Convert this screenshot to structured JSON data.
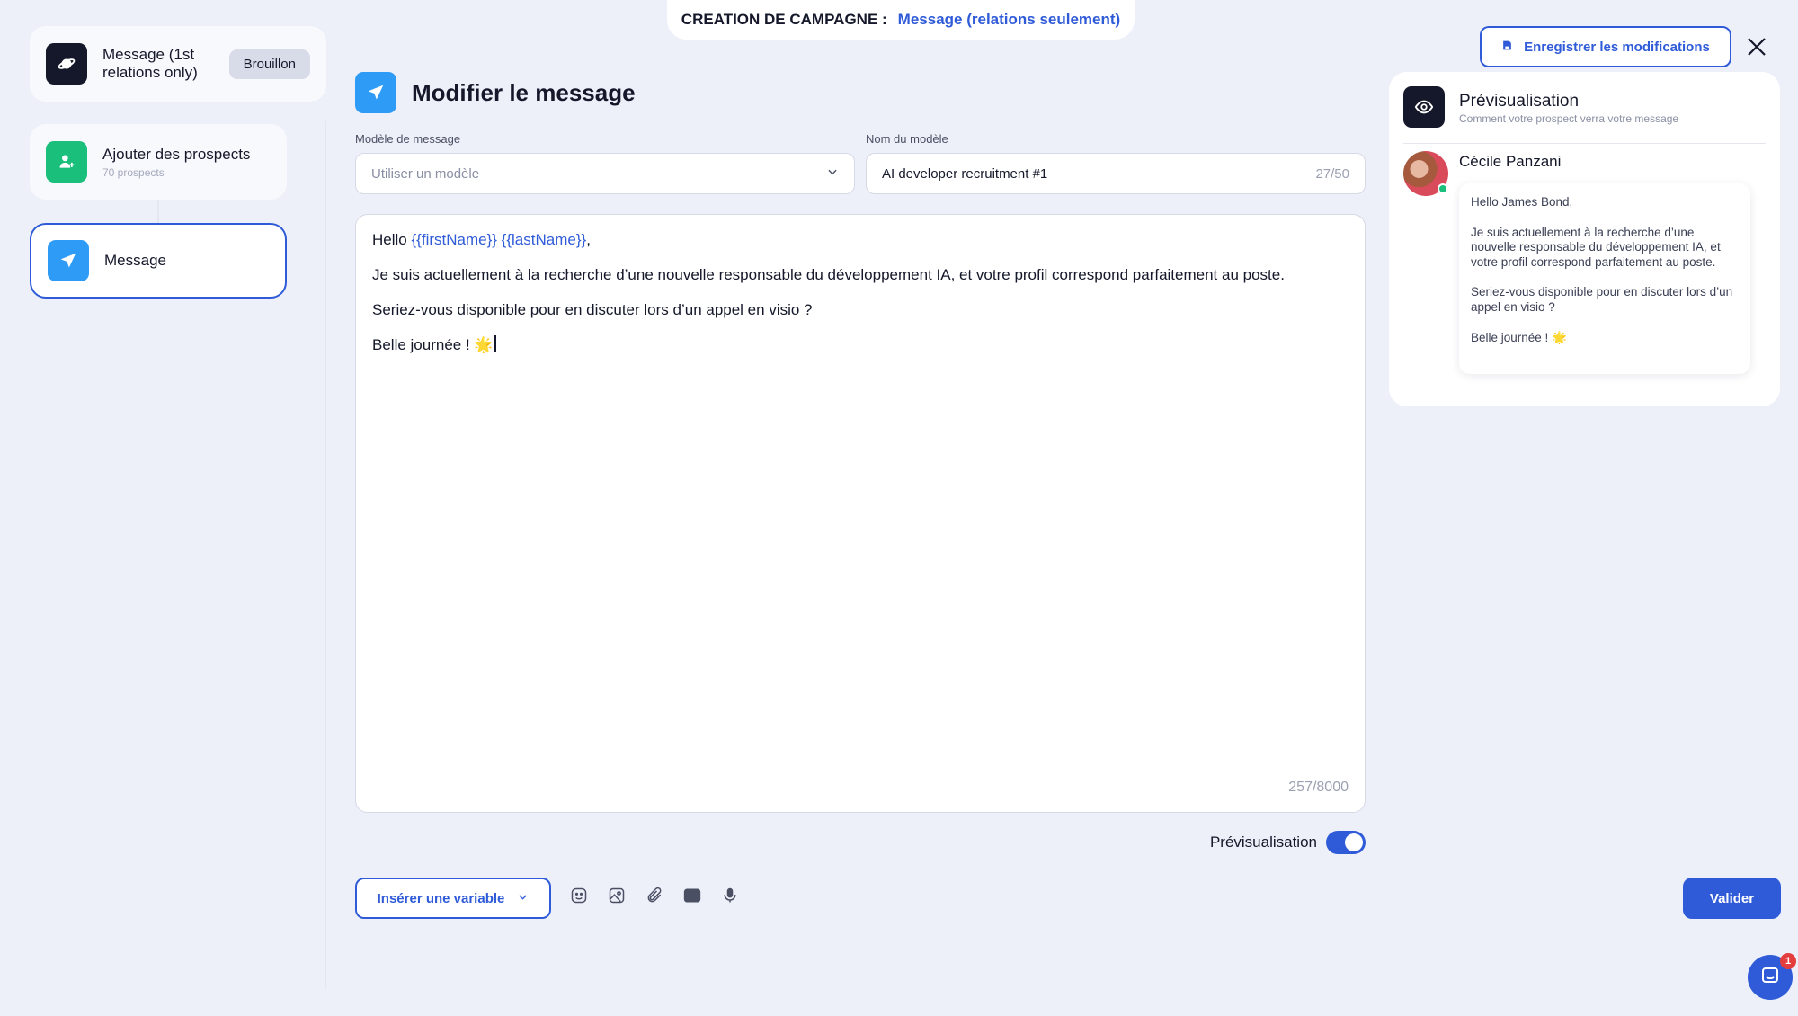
{
  "header": {
    "label": "CREATION DE CAMPAGNE :",
    "value": "Message (relations seulement)"
  },
  "steps": [
    {
      "title": "Message (1st relations only)",
      "badge": "Brouillon",
      "icon": "planet-icon"
    },
    {
      "title": "Ajouter des prospects",
      "subtitle": "70 prospects",
      "icon": "user-add-icon"
    },
    {
      "title": "Message",
      "icon": "paper-plane-icon",
      "active": true
    }
  ],
  "editor": {
    "title": "Modifier le message",
    "template_label": "Modèle de message",
    "template_placeholder": "Utiliser un modèle",
    "name_label": "Nom du modèle",
    "name_value": "AI developer recruitment #1",
    "name_count": "27/50",
    "body": {
      "greeting": "Hello",
      "var_first": "{{firstName}}",
      "var_last": "{{lastName}}",
      "comma": ",",
      "line2": "Je suis actuellement à la recherche d’une nouvelle responsable du développement IA, et votre profil correspond parfaitement au poste.",
      "line3": "Seriez-vous disponible pour en discuter lors d’un appel en visio ?",
      "line4": "Belle journée ! 🌟"
    },
    "char_count": "257/8000",
    "preview_toggle_label": "Prévisualisation",
    "preview_enabled": true,
    "insert_variable_label": "Insérer une variable",
    "toolbar_icons": [
      "emoji-icon",
      "image-icon",
      "attachment-icon",
      "gif-icon",
      "microphone-icon"
    ]
  },
  "actions": {
    "save_label": "Enregistrer les modifications",
    "validate_label": "Valider"
  },
  "preview": {
    "title": "Prévisualisation",
    "subtitle": "Comment votre prospect verra votre message",
    "sender": "Cécile Panzani",
    "message": [
      "Hello James Bond,",
      "Je suis actuellement à la recherche d’une nouvelle responsable du développement IA, et votre profil correspond parfaitement au poste.",
      "Seriez-vous disponible pour en discuter lors d’un appel en visio ?",
      "Belle journée ! 🌟"
    ]
  },
  "chat": {
    "notifications": "1"
  },
  "colors": {
    "accent": "#2f5bd8",
    "background": "#eef0f9",
    "green": "#1bbf7c",
    "sky": "#2e9bf6",
    "dark": "#15182a"
  }
}
